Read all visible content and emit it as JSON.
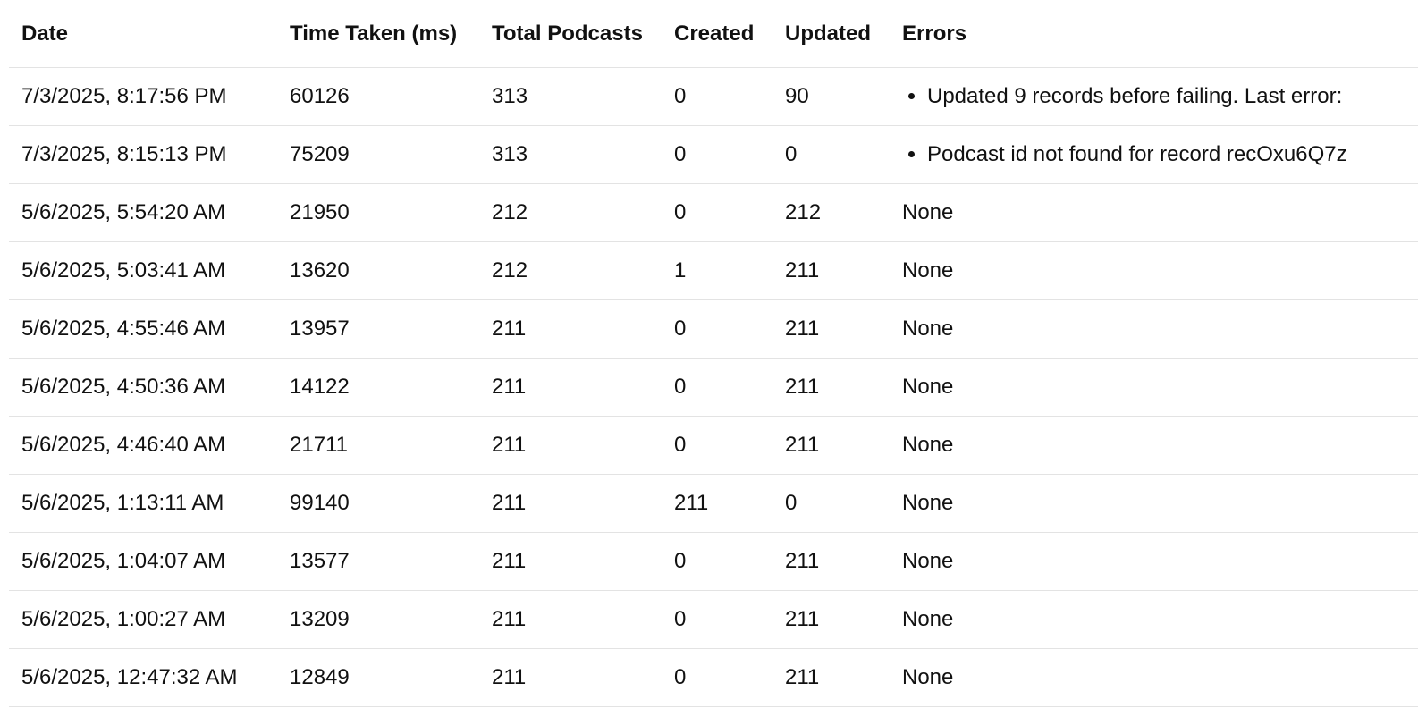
{
  "table": {
    "headers": [
      "Date",
      "Time Taken (ms)",
      "Total Podcasts",
      "Created",
      "Updated",
      "Errors"
    ],
    "rows": [
      {
        "date": "7/3/2025, 8:17:56 PM",
        "time_ms": "60126",
        "total": "313",
        "created": "0",
        "updated": "90",
        "errors": [
          "Updated 9 records before failing. Last error:"
        ]
      },
      {
        "date": "7/3/2025, 8:15:13 PM",
        "time_ms": "75209",
        "total": "313",
        "created": "0",
        "updated": "0",
        "errors": [
          "Podcast id not found for record recOxu6Q7z"
        ]
      },
      {
        "date": "5/6/2025, 5:54:20 AM",
        "time_ms": "21950",
        "total": "212",
        "created": "0",
        "updated": "212",
        "errors": "None"
      },
      {
        "date": "5/6/2025, 5:03:41 AM",
        "time_ms": "13620",
        "total": "212",
        "created": "1",
        "updated": "211",
        "errors": "None"
      },
      {
        "date": "5/6/2025, 4:55:46 AM",
        "time_ms": "13957",
        "total": "211",
        "created": "0",
        "updated": "211",
        "errors": "None"
      },
      {
        "date": "5/6/2025, 4:50:36 AM",
        "time_ms": "14122",
        "total": "211",
        "created": "0",
        "updated": "211",
        "errors": "None"
      },
      {
        "date": "5/6/2025, 4:46:40 AM",
        "time_ms": "21711",
        "total": "211",
        "created": "0",
        "updated": "211",
        "errors": "None"
      },
      {
        "date": "5/6/2025, 1:13:11 AM",
        "time_ms": "99140",
        "total": "211",
        "created": "211",
        "updated": "0",
        "errors": "None"
      },
      {
        "date": "5/6/2025, 1:04:07 AM",
        "time_ms": "13577",
        "total": "211",
        "created": "0",
        "updated": "211",
        "errors": "None"
      },
      {
        "date": "5/6/2025, 1:00:27 AM",
        "time_ms": "13209",
        "total": "211",
        "created": "0",
        "updated": "211",
        "errors": "None"
      },
      {
        "date": "5/6/2025, 12:47:32 AM",
        "time_ms": "12849",
        "total": "211",
        "created": "0",
        "updated": "211",
        "errors": "None"
      }
    ]
  }
}
